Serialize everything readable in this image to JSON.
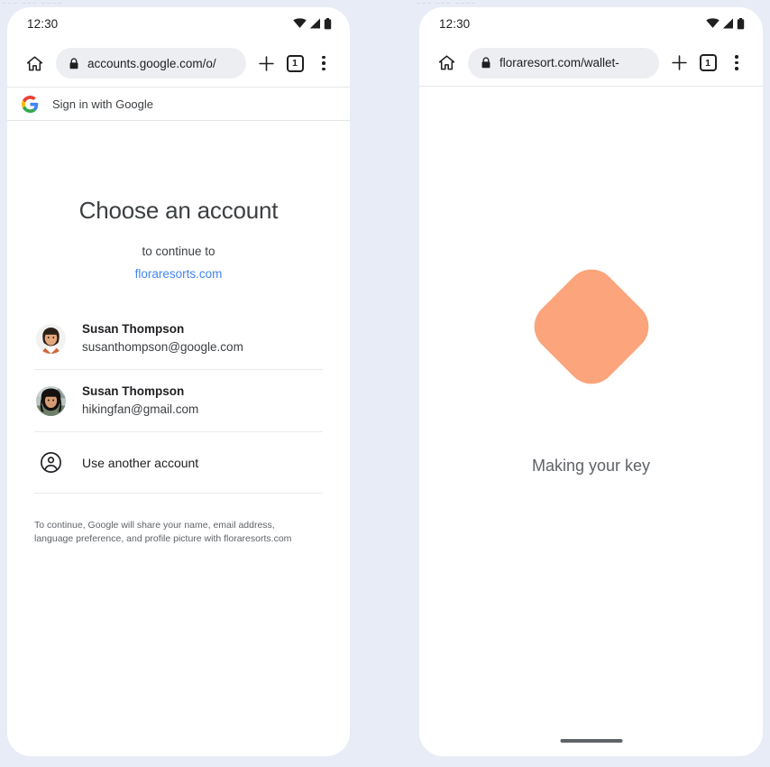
{
  "background_color": "#e8ecf6",
  "ghost_text": "–––   –––   ––––",
  "left_phone": {
    "status_bar": {
      "time": "12:30",
      "icons": [
        "wifi-icon",
        "signal-icon",
        "battery-icon"
      ]
    },
    "toolbar": {
      "home_icon": "home-icon",
      "lock_icon": "lock-icon",
      "url": "accounts.google.com/o/",
      "new_tab_icon": "plus-icon",
      "tab_count": "1",
      "menu_icon": "overflow-menu-icon"
    },
    "google_header": {
      "logo": "google-g-icon",
      "label": "Sign in with Google"
    },
    "chooser": {
      "title": "Choose an account",
      "subtitle": "to continue to",
      "domain": "floraresorts.com",
      "domain_color": "#4285f4",
      "accounts": [
        {
          "name": "Susan Thompson",
          "email": "susanthompson@google.com",
          "avatar": "avatar-susan-work"
        },
        {
          "name": "Susan Thompson",
          "email": "hikingfan@gmail.com",
          "avatar": "avatar-susan-personal"
        }
      ],
      "use_another_account": {
        "icon": "account-circle-icon",
        "label": "Use another account"
      },
      "legal_text": "To continue, Google will share your name, email address, language preference, and profile picture with floraresorts.com"
    }
  },
  "right_phone": {
    "status_bar": {
      "time": "12:30",
      "icons": [
        "wifi-icon",
        "signal-icon",
        "battery-icon"
      ]
    },
    "toolbar": {
      "home_icon": "home-icon",
      "lock_icon": "lock-icon",
      "url": "floraresort.com/wallet-",
      "new_tab_icon": "plus-icon",
      "tab_count": "1",
      "menu_icon": "overflow-menu-icon"
    },
    "wallet": {
      "shape_color": "#fca47b",
      "status_text": "Making your key"
    }
  }
}
